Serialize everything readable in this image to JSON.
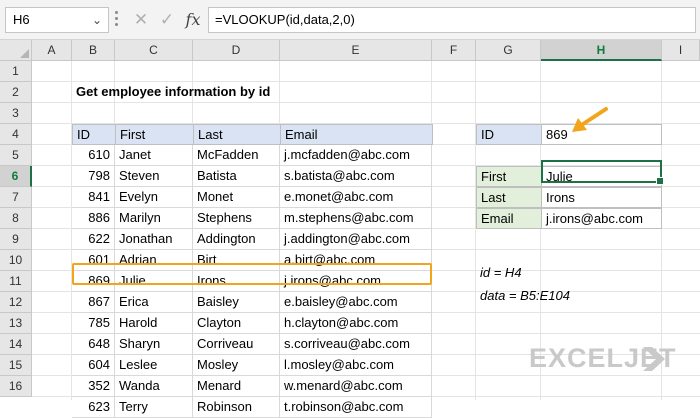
{
  "formula_bar": {
    "name_box": "H6",
    "formula": "=VLOOKUP(id,data,2,0)"
  },
  "columns": [
    "A",
    "B",
    "C",
    "D",
    "E",
    "F",
    "G",
    "H",
    "I"
  ],
  "rows": [
    "1",
    "2",
    "3",
    "4",
    "5",
    "6",
    "7",
    "8",
    "9",
    "10",
    "11",
    "12",
    "13",
    "14",
    "15",
    "16"
  ],
  "sheet": {
    "title": "Get employee information by id",
    "table_headers": [
      "ID",
      "First",
      "Last",
      "Email"
    ],
    "table_rows": [
      [
        "610",
        "Janet",
        "McFadden",
        "j.mcfadden@abc.com"
      ],
      [
        "798",
        "Steven",
        "Batista",
        "s.batista@abc.com"
      ],
      [
        "841",
        "Evelyn",
        "Monet",
        "e.monet@abc.com"
      ],
      [
        "886",
        "Marilyn",
        "Stephens",
        "m.stephens@abc.com"
      ],
      [
        "622",
        "Jonathan",
        "Addington",
        "j.addington@abc.com"
      ],
      [
        "601",
        "Adrian",
        "Birt",
        "a.birt@abc.com"
      ],
      [
        "869",
        "Julie",
        "Irons",
        "j.irons@abc.com"
      ],
      [
        "867",
        "Erica",
        "Baisley",
        "e.baisley@abc.com"
      ],
      [
        "785",
        "Harold",
        "Clayton",
        "h.clayton@abc.com"
      ],
      [
        "648",
        "Sharyn",
        "Corriveau",
        "s.corriveau@abc.com"
      ],
      [
        "604",
        "Leslee",
        "Mosley",
        "l.mosley@abc.com"
      ],
      [
        "352",
        "Wanda",
        "Menard",
        "w.menard@abc.com"
      ],
      [
        "623",
        "Terry",
        "Robinson",
        "t.robinson@abc.com"
      ]
    ],
    "lookup": {
      "id_label": "ID",
      "id_value": "869",
      "fields": [
        {
          "label": "First",
          "value": "Julie"
        },
        {
          "label": "Last",
          "value": "Irons"
        },
        {
          "label": "Email",
          "value": "j.irons@abc.com"
        }
      ]
    },
    "notes": [
      "id = H4",
      "data = B5:E104"
    ]
  },
  "logo": "EXCELJET",
  "colors": {
    "header_fill": "#dae3f3",
    "label_fill": "#e2efda",
    "highlight": "#f2a51a",
    "selection": "#1e7145"
  }
}
